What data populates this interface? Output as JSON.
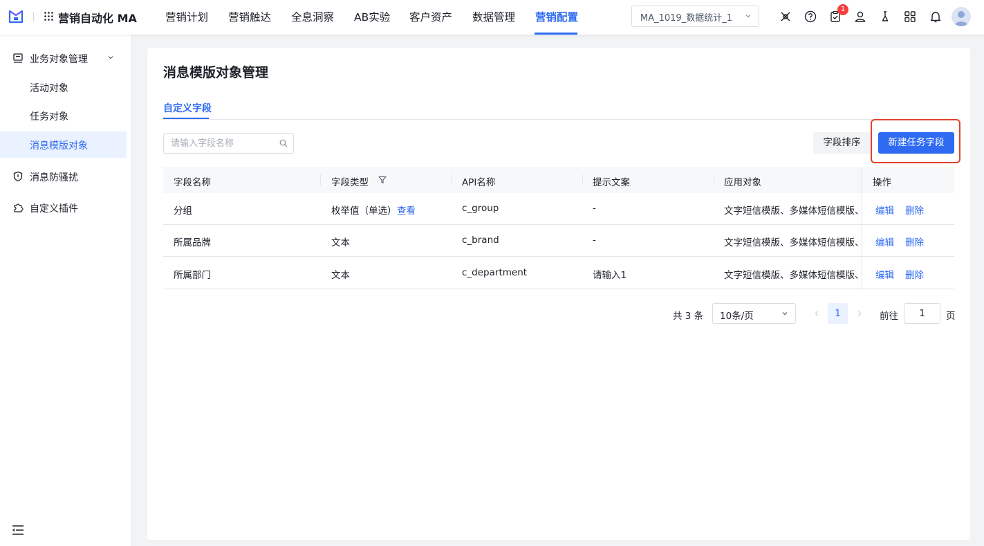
{
  "app": {
    "name": "营销自动化 MA"
  },
  "nav": {
    "items": [
      {
        "label": "营销计划"
      },
      {
        "label": "营销触达"
      },
      {
        "label": "全息洞察"
      },
      {
        "label": "AB实验"
      },
      {
        "label": "客户资产"
      },
      {
        "label": "数据管理"
      },
      {
        "label": "营销配置",
        "active": true
      }
    ]
  },
  "workspace": {
    "selected": "MA_1019_数据统计_1"
  },
  "notifications": {
    "todo_count": "1"
  },
  "sidebar": {
    "groups": [
      {
        "label": "业务对象管理",
        "expanded": true,
        "icon": "object-manage-icon"
      },
      {
        "label": "消息防骚扰",
        "icon": "shield-icon"
      },
      {
        "label": "自定义插件",
        "icon": "plugin-icon"
      }
    ],
    "sub_items": [
      {
        "label": "活动对象"
      },
      {
        "label": "任务对象"
      },
      {
        "label": "消息模版对象",
        "active": true
      }
    ]
  },
  "page": {
    "title": "消息模版对象管理",
    "tabs": [
      {
        "label": "自定义字段",
        "active": true
      }
    ],
    "search": {
      "placeholder": "请输入字段名称",
      "value": ""
    },
    "sort_button": "字段排序",
    "new_button": "新建任务字段"
  },
  "table": {
    "columns": [
      "字段名称",
      "字段类型",
      "API名称",
      "提示文案",
      "应用对象",
      "操作"
    ],
    "rows": [
      {
        "name": "分组",
        "type": "枚举值（单选）",
        "type_link": "查看",
        "api": "c_group",
        "hint": "-",
        "apply": "文字短信模版、多媒体短信模版、APP推送模版",
        "edit": "编辑",
        "delete": "删除"
      },
      {
        "name": "所属品牌",
        "type": "文本",
        "type_link": "",
        "api": "c_brand",
        "hint": "-",
        "apply": "文字短信模版、多媒体短信模版、APP推送模版",
        "edit": "编辑",
        "delete": "删除"
      },
      {
        "name": "所属部门",
        "type": "文本",
        "type_link": "",
        "api": "c_department",
        "hint": "请输入1",
        "apply": "文字短信模版、多媒体短信模版、APP推送模版",
        "edit": "编辑",
        "delete": "删除"
      }
    ]
  },
  "pagination": {
    "total": "共 3 条",
    "page_size": "10条/页",
    "current": "1",
    "goto_label": "前往",
    "goto_value": "1",
    "unit": "页"
  },
  "colors": {
    "accent": "#2f6bf2",
    "highlight": "#e0422d",
    "badge": "#f53f3f"
  }
}
